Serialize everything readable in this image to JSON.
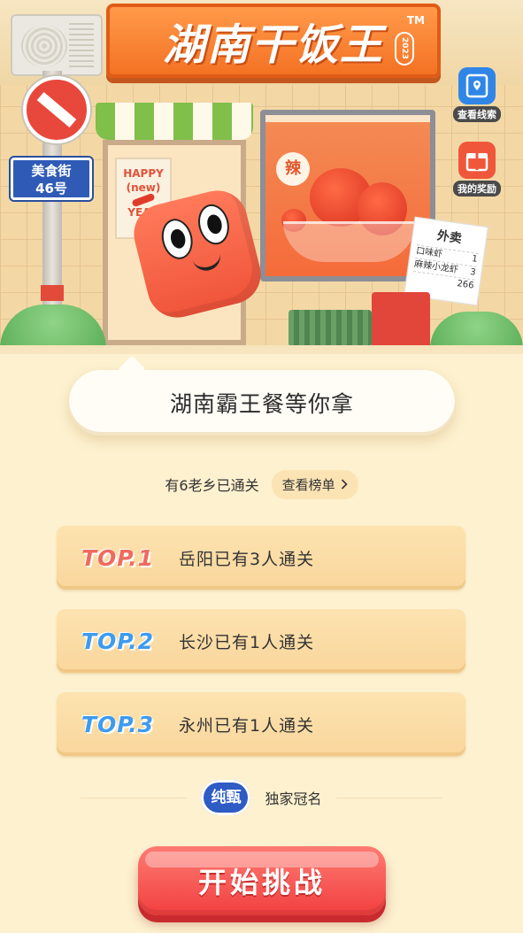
{
  "scene": {
    "title": "湖南干饭王",
    "title_year": "2023",
    "title_tm": "TM",
    "street_sign_line1": "美食街",
    "street_sign_line2": "46号",
    "poster_line1": "HAPPY",
    "poster_line2": "(new)",
    "poster_line3": "YEAR",
    "spicy_badge": "辣",
    "receipt": {
      "title": "外卖",
      "lines": [
        {
          "item": "口味虾",
          "qty": "1"
        },
        {
          "item": "麻辣小龙虾",
          "qty": "3"
        },
        {
          "item": "",
          "qty": "266"
        }
      ]
    }
  },
  "side_buttons": {
    "clues": {
      "label": "查看线索",
      "icon": "map-pin-icon",
      "color": "#2f86e6"
    },
    "rewards": {
      "label": "我的奖励",
      "icon": "gift-icon",
      "color": "#f0573a"
    }
  },
  "main": {
    "bubble_text": "湖南霸王餐等你拿",
    "pass_text": "有6老乡已通关",
    "rank_button": "查看榜单",
    "ranks": [
      {
        "top": "TOP.1",
        "text": "岳阳已有3人通关",
        "color": "#f06a5e"
      },
      {
        "top": "TOP.2",
        "text": "长沙已有1人通关",
        "color": "#3d9bf0"
      },
      {
        "top": "TOP.3",
        "text": "永州已有1人通关",
        "color": "#3d9bf0"
      }
    ],
    "sponsor_logo": "纯甄",
    "sponsor_text": "独家冠名",
    "start_button": "开始挑战"
  }
}
